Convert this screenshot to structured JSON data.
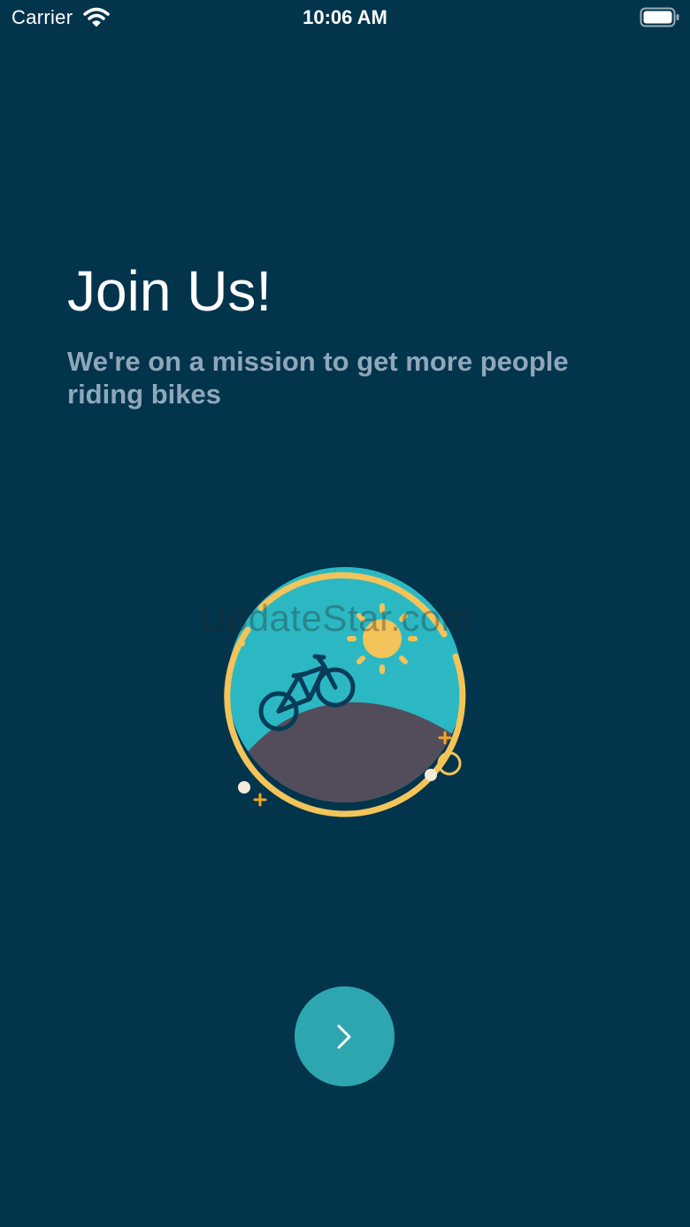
{
  "status_bar": {
    "carrier": "Carrier",
    "time": "10:06 AM",
    "wifi_icon": "wifi-icon",
    "battery_icon": "battery-icon"
  },
  "onboarding": {
    "title": "Join Us!",
    "subtitle": "We're on a mission to get more people riding bikes",
    "illustration": "bike-hill-sun-illustration",
    "next_icon": "chevron-right-icon"
  },
  "watermark": "UpdateStar.com",
  "colors": {
    "background": "#02344c",
    "accent": "#2ea6b0",
    "subtitle": "#8fa7bb",
    "sky": "#2bb8c3",
    "sun": "#f2c45a",
    "hill": "#534d5b"
  }
}
